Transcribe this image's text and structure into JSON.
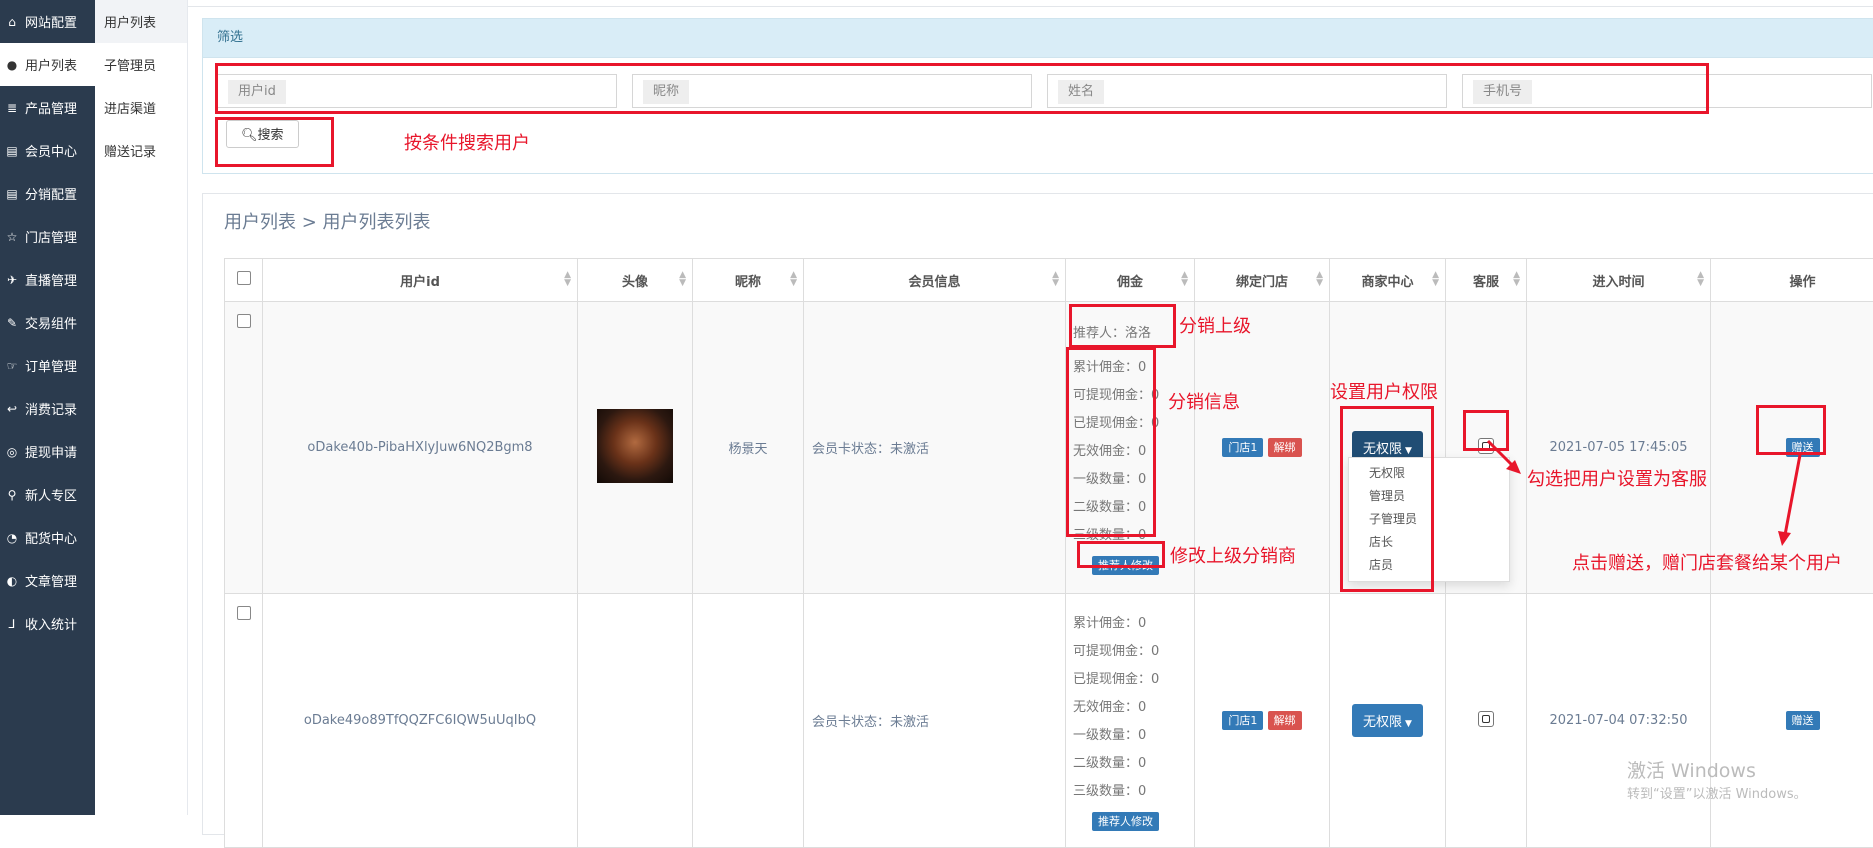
{
  "sidebar": {
    "items": [
      {
        "icon": "home-icon",
        "glyph": "⌂",
        "label": "网站配置"
      },
      {
        "icon": "user-icon",
        "glyph": "●",
        "label": "用户列表",
        "active": true
      },
      {
        "icon": "server-icon",
        "glyph": "≣",
        "label": "产品管理"
      },
      {
        "icon": "cart-icon",
        "glyph": "▤",
        "label": "会员中心"
      },
      {
        "icon": "cart-icon",
        "glyph": "▤",
        "label": "分销配置"
      },
      {
        "icon": "star-icon",
        "glyph": "☆",
        "label": "门店管理"
      },
      {
        "icon": "plane-icon",
        "glyph": "✈",
        "label": "直播管理"
      },
      {
        "icon": "eraser-icon",
        "glyph": "✎",
        "label": "交易组件"
      },
      {
        "icon": "hand-icon",
        "glyph": "☞",
        "label": "订单管理"
      },
      {
        "icon": "reply-icon",
        "glyph": "↩",
        "label": "消费记录"
      },
      {
        "icon": "wechat-icon",
        "glyph": "◎",
        "label": "提现申请"
      },
      {
        "icon": "pin-icon",
        "glyph": "⚲",
        "label": "新人专区"
      },
      {
        "icon": "pie-chart-icon",
        "glyph": "◔",
        "label": "配货中心"
      },
      {
        "icon": "contrast-icon",
        "glyph": "◐",
        "label": "文章管理"
      },
      {
        "icon": "git-icon",
        "glyph": "⅃",
        "label": "收入统计"
      }
    ]
  },
  "subnav": {
    "items": [
      {
        "label": "用户列表",
        "active": true
      },
      {
        "label": "子管理员"
      },
      {
        "label": "进店渠道"
      },
      {
        "label": "赠送记录"
      }
    ]
  },
  "filter": {
    "title": "筛选",
    "fields": [
      {
        "addon": "用户id",
        "value": ""
      },
      {
        "addon": "昵称",
        "value": ""
      },
      {
        "addon": "姓名",
        "value": ""
      },
      {
        "addon": "手机号",
        "value": ""
      }
    ],
    "search_label": "搜索"
  },
  "breadcrumb": "用户列表 > 用户列表列表",
  "table": {
    "headers": [
      "用户id",
      "头像",
      "昵称",
      "会员信息",
      "佣金",
      "绑定门店",
      "商家中心",
      "客服",
      "进入时间",
      "操作"
    ],
    "rows": [
      {
        "user_id": "oDake40b-PibaHXlyJuw6NQ2Bgm8",
        "nickname": "杨景天",
        "member_info": "会员卡状态：未激活",
        "referrer": "推荐人：洛洛",
        "commission_lines": [
          "累计佣金：0",
          "可提现佣金：0",
          "已提现佣金：0",
          "无效佣金：0",
          "一级数量：0",
          "二级数量：0",
          "三级数量：0"
        ],
        "referrer_button": "推荐人修改",
        "store_tag": "门店1",
        "unbind_label": "解绑",
        "permission": "无权限",
        "join_time": "2021-07-05 17:45:05",
        "action": "赠送"
      },
      {
        "user_id": "oDake49o89TfQQZFC6IQW5uUqIbQ",
        "nickname": "",
        "member_info": "会员卡状态：未激活",
        "commission_lines": [
          "累计佣金：0",
          "可提现佣金：0",
          "已提现佣金：0",
          "无效佣金：0",
          "一级数量：0",
          "二级数量：0",
          "三级数量：0"
        ],
        "referrer_button": "推荐人修改",
        "store_tag": "门店1",
        "unbind_label": "解绑",
        "permission": "无权限",
        "join_time": "2021-07-04 07:32:50",
        "action": "赠送"
      }
    ]
  },
  "permission_dropdown": [
    "无权限",
    "管理员",
    "子管理员",
    "店长",
    "店员"
  ],
  "annotations": {
    "search_note": "按条件搜索用户",
    "upline_note": "分销上级",
    "commission_note": "分销信息",
    "permission_note": "设置用户权限",
    "kefu_note": "勾选把用户设置为客服",
    "referrer_note": "修改上级分销商",
    "gift_note": "点击赠送，赠门店套餐给某个用户"
  },
  "watermark": {
    "line1": "激活 Windows",
    "line2": "转到“设置”以激活 Windows。"
  },
  "colors": {
    "sidebar": "#2b3b4e",
    "primary": "#337ab7",
    "danger": "#d9534f",
    "annotation": "#e8162b",
    "filter_header": "#d9edf7"
  }
}
